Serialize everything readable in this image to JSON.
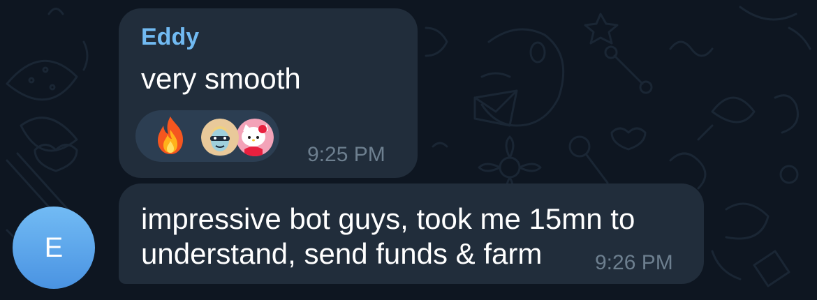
{
  "messages": [
    {
      "sender": "Eddy",
      "text": "very smooth",
      "time": "9:25 PM",
      "reaction_icon": "fire-emoji"
    },
    {
      "text_line1": "impressive bot guys, took me 15mn to",
      "text_line2": "understand, send funds & farm",
      "time": "9:26 PM"
    }
  ],
  "avatar": {
    "initial": "E",
    "color": "#5ba6ec"
  },
  "colors": {
    "background": "#0e1621",
    "bubble": "#212d3b",
    "sender_name": "#71baf2",
    "timestamp": "#6d7f8f",
    "reaction_pill": "#2c3e52"
  }
}
